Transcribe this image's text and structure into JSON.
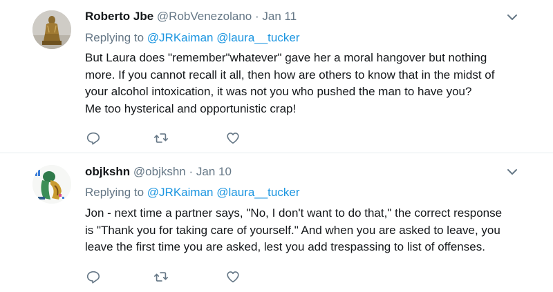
{
  "colors": {
    "link": "#1b95e0",
    "secondary_text": "#657786",
    "primary_text": "#14171a",
    "divider": "#e6ecf0"
  },
  "tweets": [
    {
      "display_name": "Roberto Jbe",
      "handle": "@RobVenezolano",
      "separator": "·",
      "date": "Jan 11",
      "replying_prefix": "Replying to",
      "mentions": [
        "@JRKaiman",
        "@laura__tucker"
      ],
      "body_lines": [
        "But Laura does \"remember\"whatever\" gave her a moral hangover but nothing",
        "more. If you cannot recall it all, then how are others to know that in the midst of",
        "your alcohol intoxication, it was not you who pushed the man to have you?",
        "Me too hysterical and opportunistic crap!"
      ],
      "avatar_icon": "statue-avatar-icon"
    },
    {
      "display_name": "objkshn",
      "handle": "@objkshn",
      "separator": "·",
      "date": "Jan 10",
      "replying_prefix": "Replying to",
      "mentions": [
        "@JRKaiman",
        "@laura__tucker"
      ],
      "body_lines": [
        "Jon - next time a partner says, \"No, I don't want to do that,\" the correct response",
        "is \"Thank you for taking care of yourself.\"  And when you are asked to leave, you",
        "leave the first time you are asked, lest you add trespassing to list of offenses."
      ],
      "avatar_icon": "illustrated-avatar-icon"
    }
  ],
  "icons": {
    "reply": "reply-icon",
    "retweet": "retweet-icon",
    "like": "heart-icon",
    "menu": "chevron-down-icon"
  }
}
